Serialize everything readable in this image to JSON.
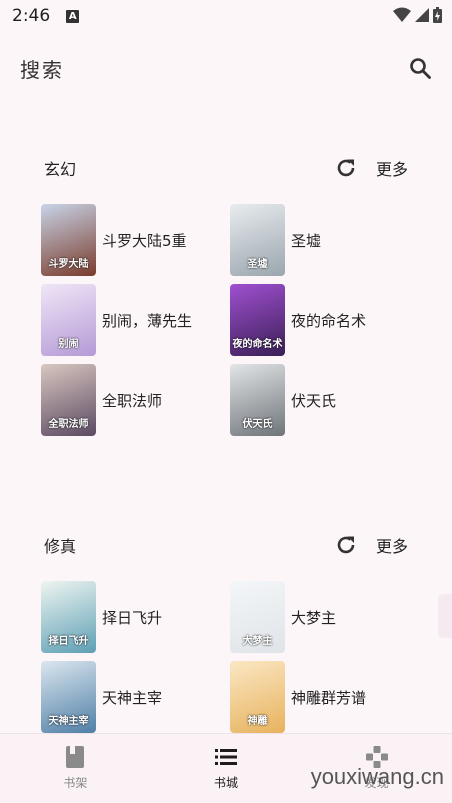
{
  "status": {
    "time": "2:46",
    "notif_badge": "A"
  },
  "search": {
    "label": "搜索",
    "icon": "search-icon"
  },
  "sections": [
    {
      "title": "玄幻",
      "more": "更多",
      "books": [
        {
          "title": "斗罗大陆5重",
          "cover_text": "斗罗大陆",
          "cover_colors": [
            "#7a3b2c",
            "#c8d4e8"
          ]
        },
        {
          "title": "圣墟",
          "cover_text": "圣墟",
          "cover_colors": [
            "#9aa5ad",
            "#e8ecef"
          ]
        },
        {
          "title": "别闹，薄先生",
          "cover_text": "别闹",
          "cover_colors": [
            "#b49ad6",
            "#f0e6f7"
          ]
        },
        {
          "title": "夜的命名术",
          "cover_text": "夜的命名术",
          "cover_colors": [
            "#3a1f57",
            "#a050d0"
          ]
        },
        {
          "title": "全职法师",
          "cover_text": "全职法师",
          "cover_colors": [
            "#5b4a63",
            "#d9c7c0"
          ]
        },
        {
          "title": "伏天氏",
          "cover_text": "伏天氏",
          "cover_colors": [
            "#6e7479",
            "#e3e5e7"
          ]
        }
      ]
    },
    {
      "title": "修真",
      "more": "更多",
      "books": [
        {
          "title": "择日飞升",
          "cover_text": "择日飞升",
          "cover_colors": [
            "#5e9fb5",
            "#eef5f0"
          ]
        },
        {
          "title": "大梦主",
          "cover_text": "大梦主",
          "cover_colors": [
            "#dfe4e8",
            "#f4f6f8"
          ]
        },
        {
          "title": "天神主宰",
          "cover_text": "天神主宰",
          "cover_colors": [
            "#4f7fa6",
            "#dbe6ef"
          ]
        },
        {
          "title": "神雕群芳谱",
          "cover_text": "神雕",
          "cover_colors": [
            "#e7b25d",
            "#fbe7c4"
          ]
        }
      ]
    }
  ],
  "bottom_nav": [
    {
      "label": "书架",
      "icon": "book-icon",
      "active": false
    },
    {
      "label": "书城",
      "icon": "list-icon",
      "active": true
    },
    {
      "label": "发现",
      "icon": "game-icon",
      "active": false
    }
  ],
  "watermark": "youxiwang.cn"
}
